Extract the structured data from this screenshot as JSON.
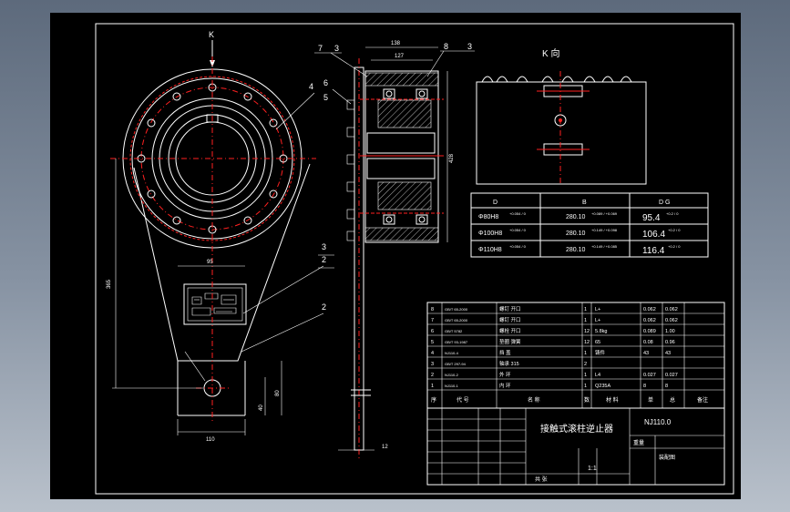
{
  "colors": {
    "background": "#5d6a7c",
    "sheet": "#000000",
    "line": "#ffffff",
    "centerline": "#ff2020"
  },
  "front_view": {
    "label_k": "K",
    "dim_110": "110",
    "dim_95": "95",
    "dim_365": "365",
    "dim_40": "40",
    "dim_80": "80"
  },
  "side_view": {
    "dim_138": "138",
    "dim_127": "127",
    "dim_428": "428",
    "dim_12": "12",
    "callouts": {
      "c7": "7",
      "c3a": "3",
      "c8": "8",
      "c3b": "3",
      "c6": "6",
      "c5": "5",
      "c4": "4",
      "c3c": "3",
      "c2a": "2",
      "c2b": "2"
    }
  },
  "k_view": {
    "title": "K 向"
  },
  "size_table": {
    "header": [
      "D",
      "B",
      "D G"
    ],
    "rows": [
      {
        "d": "Φ80H8",
        "d_tol": "+0.054 / 0",
        "b": "280.10",
        "b_tol": "+0.089 / +0.069",
        "g": "95.4",
        "g_tol": "+0.2 / 0"
      },
      {
        "d": "Φ100H8",
        "d_tol": "+0.054 / 0",
        "b": "280.10",
        "b_tol": "+0.149 / +0.098",
        "g": "106.4",
        "g_tol": "+0.2 / 0"
      },
      {
        "d": "Φ110H8",
        "d_tol": "+0.054 / 0",
        "b": "280.10",
        "b_tol": "+0.149 / +0.085",
        "g": "116.4",
        "g_tol": "+0.2 / 0"
      }
    ]
  },
  "parts_list": [
    {
      "no": "8",
      "code": "GB/T 65-2000",
      "name": "螺钉 开口",
      "qty": "1",
      "mat": "L+",
      "m1": "0.062",
      "m2": "0.062"
    },
    {
      "no": "7",
      "code": "GB/T 65-2000",
      "name": "螺钉 开口",
      "qty": "1",
      "mat": "L+",
      "m1": "0.062",
      "m2": "0.062"
    },
    {
      "no": "6",
      "code": "GB/T 5782",
      "name": "螺栓 开口",
      "qty": "12",
      "mat": "5.8kg",
      "m1": "0.089",
      "m2": "1.00"
    },
    {
      "no": "5",
      "code": "GB/T 93-1987",
      "name": "垫圈 弹簧",
      "qty": "12",
      "mat": "65",
      "m1": "0.08",
      "m2": "0.96"
    },
    {
      "no": "4",
      "code": "NJ110-4",
      "name": "挡 盖",
      "qty": "1",
      "mat": "铸件",
      "m1": "43",
      "m2": "43"
    },
    {
      "no": "3",
      "code": "GB/T 297-94",
      "name": "轴承 315",
      "qty": "2",
      "mat": "",
      "m1": "",
      "m2": ""
    },
    {
      "no": "2",
      "code": "NJ110-2",
      "name": "外 环",
      "qty": "1",
      "mat": "L4",
      "m1": "0.027",
      "m2": "0.027"
    },
    {
      "no": "1",
      "code": "NJ110-1",
      "name": "内 环",
      "qty": "1",
      "mat": "Q235A",
      "m1": "8",
      "m2": "8"
    }
  ],
  "parts_header": {
    "no": "序",
    "code": "代 号",
    "name": "名 称",
    "qty": "数",
    "mat": "材 料",
    "m1": "单",
    "m2": "总",
    "note": "备注"
  },
  "title_block": {
    "title": "接触式滚柱逆止器",
    "drawing_no": "NJ110.0",
    "scale": "1:1",
    "sheet_label": "共 张",
    "weight": "重量",
    "material_code": "装配图"
  }
}
